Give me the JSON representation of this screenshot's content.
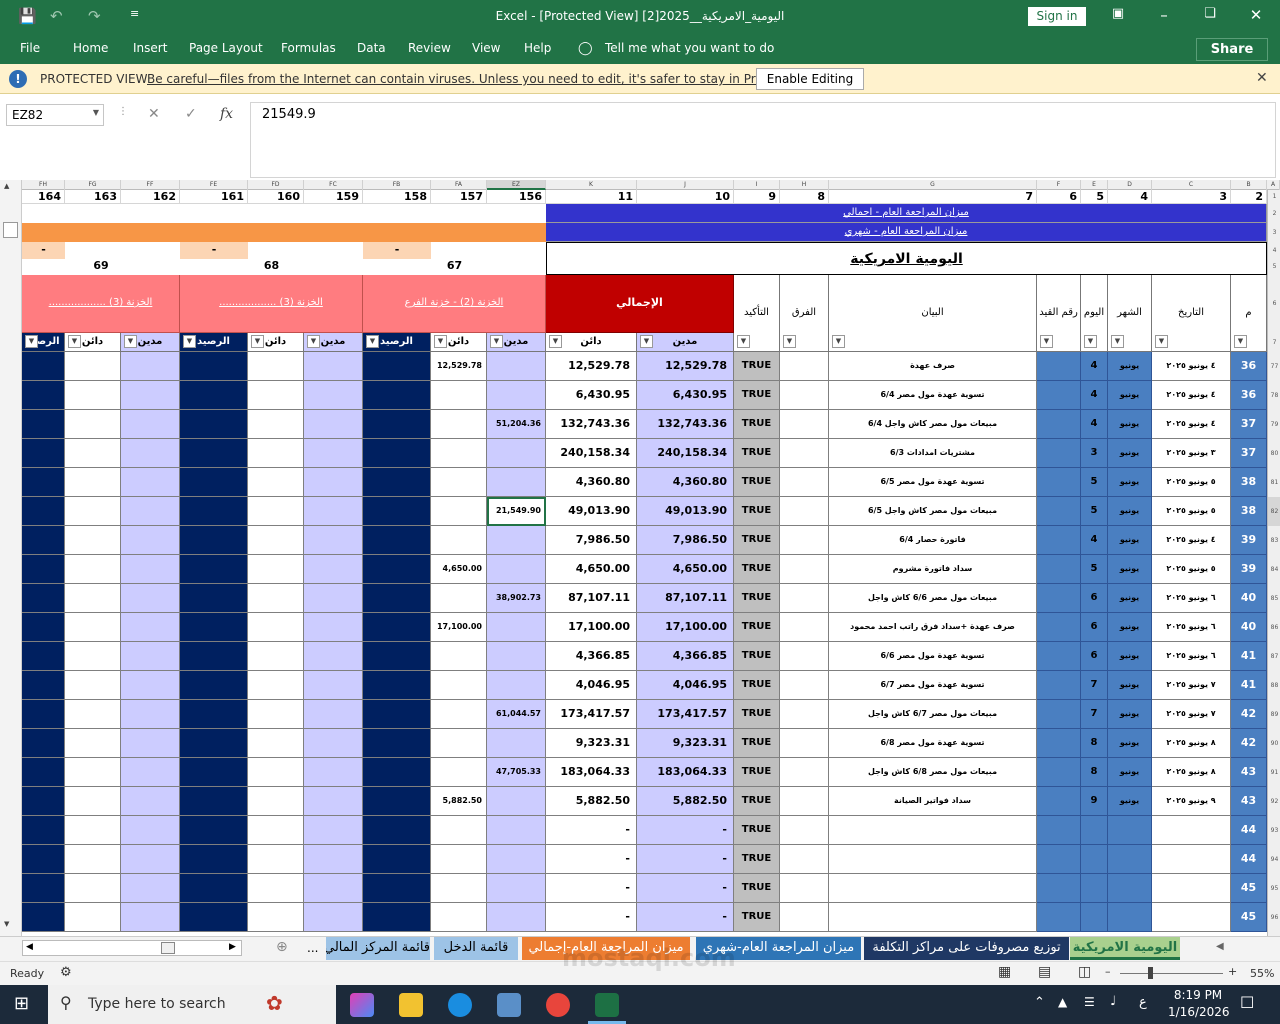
{
  "app": {
    "title": "اليومية_الامريكية__2025[2]  [Protected View]  -  Excel",
    "signin": "Sign in",
    "share": "Share"
  },
  "ribbon_tabs": [
    "File",
    "Home",
    "Insert",
    "Page Layout",
    "Formulas",
    "Data",
    "Review",
    "View",
    "Help"
  ],
  "tell_me": "Tell me what you want to do",
  "protected_view": {
    "label": "PROTECTED VIEW",
    "message": "Be careful—files from the Internet can contain viruses. Unless you need to edit, it's safer to stay in Protected View.",
    "button": "Enable Editing"
  },
  "formula_bar": {
    "name_box": "EZ82",
    "fx": "fx",
    "value": "21549.9"
  },
  "col_letters": [
    "FH",
    "FG",
    "FF",
    "FE",
    "FD",
    "FC",
    "FB",
    "FA",
    "EZ",
    "K",
    "J",
    "I",
    "H",
    "G",
    "F",
    "E",
    "D",
    "C",
    "B",
    "A"
  ],
  "row1_numbers": [
    "164",
    "163",
    "162",
    "161",
    "160",
    "159",
    "158",
    "157",
    "156",
    "11",
    "10",
    "9",
    "8",
    "7",
    "6",
    "5",
    "4",
    "3",
    "2"
  ],
  "banners": {
    "total_review": "ميزان المراجعة العام - اجمالي",
    "monthly_review": "ميزان المراجعة العام - شهري",
    "journal_title": "اليومية الامريكية"
  },
  "group_numbers": [
    "69",
    "68",
    "67"
  ],
  "dashes": [
    "-",
    "-",
    "-"
  ],
  "safes": {
    "safe3a": "الخزنة (3) ..................",
    "safe3b": "الخزنة (3) ..................",
    "safe2": "الخزنة (2) - خزنة الفرع",
    "total": "الإجمالي"
  },
  "headers": {
    "m": "م",
    "date": "التاريخ",
    "month": "الشهر",
    "day": "اليوم",
    "entry": "رقم القيد",
    "statement": "البيان",
    "diff": "الفرق",
    "confirm": "التأكيد",
    "debit": "مدين",
    "credit": "دائن",
    "balance": "الرصيد",
    "balance_cut": "الرصي"
  },
  "rows": [
    {
      "m": "36",
      "date": "٤ يونيو ٢٠٢٥",
      "month": "يونيو",
      "day": "4",
      "stmt": "صرف عهدة",
      "debit": "12,529.78",
      "credit": "12,529.78",
      "confirm": "TRUE",
      "ez": "",
      "fa": "12,529.78",
      "rn": "77"
    },
    {
      "m": "36",
      "date": "٤ يونيو ٢٠٢٥",
      "month": "يونيو",
      "day": "4",
      "stmt": "تسوية عهدة مول مصر 6/4",
      "debit": "6,430.95",
      "credit": "6,430.95",
      "confirm": "TRUE",
      "ez": "",
      "fa": "",
      "rn": "78"
    },
    {
      "m": "37",
      "date": "٤ يونيو ٢٠٢٥",
      "month": "يونيو",
      "day": "4",
      "stmt": "مبيعات مول مصر كاش واجل 6/4",
      "debit": "132,743.36",
      "credit": "132,743.36",
      "confirm": "TRUE",
      "ez": "51,204.36",
      "fa": "",
      "rn": "79"
    },
    {
      "m": "37",
      "date": "٣ يونيو ٢٠٢٥",
      "month": "يونيو",
      "day": "3",
      "stmt": "مشتريات امدادات 6/3",
      "debit": "240,158.34",
      "credit": "240,158.34",
      "confirm": "TRUE",
      "ez": "",
      "fa": "",
      "rn": "80"
    },
    {
      "m": "38",
      "date": "٥ يونيو ٢٠٢٥",
      "month": "يونيو",
      "day": "5",
      "stmt": "تسوية عهدة مول مصر 6/5",
      "debit": "4,360.80",
      "credit": "4,360.80",
      "confirm": "TRUE",
      "ez": "",
      "fa": "",
      "rn": "81"
    },
    {
      "m": "38",
      "date": "٥ يونيو ٢٠٢٥",
      "month": "يونيو",
      "day": "5",
      "stmt": "مبيعات مول مصر كاش واجل 6/5",
      "debit": "49,013.90",
      "credit": "49,013.90",
      "confirm": "TRUE",
      "ez": "21,549.90",
      "fa": "",
      "rn": "82"
    },
    {
      "m": "39",
      "date": "٤ يونيو ٢٠٢٥",
      "month": "يونيو",
      "day": "4",
      "stmt": "فاتورة حصار 6/4",
      "debit": "7,986.50",
      "credit": "7,986.50",
      "confirm": "TRUE",
      "ez": "",
      "fa": "",
      "rn": "83"
    },
    {
      "m": "39",
      "date": "٥ يونيو ٢٠٢٥",
      "month": "يونيو",
      "day": "5",
      "stmt": "سداد فاتورة مشروم",
      "debit": "4,650.00",
      "credit": "4,650.00",
      "confirm": "TRUE",
      "ez": "",
      "fa": "4,650.00",
      "rn": "84"
    },
    {
      "m": "40",
      "date": "٦ يونيو ٢٠٢٥",
      "month": "يونيو",
      "day": "6",
      "stmt": "مبيعات مول مصر 6/6 كاش واجل",
      "debit": "87,107.11",
      "credit": "87,107.11",
      "confirm": "TRUE",
      "ez": "38,902.73",
      "fa": "",
      "rn": "85"
    },
    {
      "m": "40",
      "date": "٦ يونيو ٢٠٢٥",
      "month": "يونيو",
      "day": "6",
      "stmt": "صرف عهدة +سداد فرق راتب احمد محمود",
      "debit": "17,100.00",
      "credit": "17,100.00",
      "confirm": "TRUE",
      "ez": "",
      "fa": "17,100.00",
      "rn": "86"
    },
    {
      "m": "41",
      "date": "٦ يونيو ٢٠٢٥",
      "month": "يونيو",
      "day": "6",
      "stmt": "تسوية عهدة مول مصر 6/6",
      "debit": "4,366.85",
      "credit": "4,366.85",
      "confirm": "TRUE",
      "ez": "",
      "fa": "",
      "rn": "87"
    },
    {
      "m": "41",
      "date": "٧ يونيو ٢٠٢٥",
      "month": "يونيو",
      "day": "7",
      "stmt": "تسوية عهدة مول مصر 6/7",
      "debit": "4,046.95",
      "credit": "4,046.95",
      "confirm": "TRUE",
      "ez": "",
      "fa": "",
      "rn": "88"
    },
    {
      "m": "42",
      "date": "٧ يونيو ٢٠٢٥",
      "month": "يونيو",
      "day": "7",
      "stmt": "مبيعات مول مصر 6/7 كاش واجل",
      "debit": "173,417.57",
      "credit": "173,417.57",
      "confirm": "TRUE",
      "ez": "61,044.57",
      "fa": "",
      "rn": "89"
    },
    {
      "m": "42",
      "date": "٨ يونيو ٢٠٢٥",
      "month": "يونيو",
      "day": "8",
      "stmt": "تسوية عهدة مول مصر 6/8",
      "debit": "9,323.31",
      "credit": "9,323.31",
      "confirm": "TRUE",
      "ez": "",
      "fa": "",
      "rn": "90"
    },
    {
      "m": "43",
      "date": "٨ يونيو ٢٠٢٥",
      "month": "يونيو",
      "day": "8",
      "stmt": "مبيعات مول مصر 6/8 كاش واجل",
      "debit": "183,064.33",
      "credit": "183,064.33",
      "confirm": "TRUE",
      "ez": "47,705.33",
      "fa": "",
      "rn": "91"
    },
    {
      "m": "43",
      "date": "٩ يونيو ٢٠٢٥",
      "month": "يونيو",
      "day": "9",
      "stmt": "سداد فواتير الصيانة",
      "debit": "5,882.50",
      "credit": "5,882.50",
      "confirm": "TRUE",
      "ez": "",
      "fa": "5,882.50",
      "rn": "92"
    },
    {
      "m": "44",
      "date": "",
      "month": "",
      "day": "",
      "stmt": "",
      "debit": "-",
      "credit": "-",
      "confirm": "TRUE",
      "ez": "",
      "fa": "",
      "rn": "93"
    },
    {
      "m": "44",
      "date": "",
      "month": "",
      "day": "",
      "stmt": "",
      "debit": "-",
      "credit": "-",
      "confirm": "TRUE",
      "ez": "",
      "fa": "",
      "rn": "94"
    },
    {
      "m": "45",
      "date": "",
      "month": "",
      "day": "",
      "stmt": "",
      "debit": "-",
      "credit": "-",
      "confirm": "TRUE",
      "ez": "",
      "fa": "",
      "rn": "95"
    },
    {
      "m": "45",
      "date": "",
      "month": "",
      "day": "",
      "stmt": "",
      "debit": "-",
      "credit": "-",
      "confirm": "TRUE",
      "ez": "",
      "fa": "",
      "rn": "96"
    }
  ],
  "top_row_numbers": [
    "1",
    "2",
    "3",
    "4",
    "5",
    "6",
    "7"
  ],
  "sheet_tabs": [
    {
      "label": "اليومية الامريكية",
      "bg": "#ffffff",
      "fg": "#217346",
      "active": true
    },
    {
      "label": "توزيع مصروفات على مراكز التكلفة",
      "bg": "#1f3864",
      "fg": "#ffffff"
    },
    {
      "label": "ميزان المراجعة العام-شهري",
      "bg": "#2e75b6",
      "fg": "#ffffff"
    },
    {
      "label": "ميزان المراجعة العام-إجمالي",
      "bg": "#ed7d31",
      "fg": "#ffffff"
    },
    {
      "label": "قائمة الدخل",
      "bg": "#9dc3e6",
      "fg": "#000000"
    },
    {
      "label": "قائمة المركز المالي",
      "bg": "#9dc3e6",
      "fg": "#000000"
    }
  ],
  "sheet_more": "...",
  "status": {
    "ready": "Ready",
    "zoom": "55%"
  },
  "taskbar": {
    "search": "Type here to search",
    "time": "8:19 PM",
    "date": "1/16/2026",
    "lang": "ع"
  },
  "watermark": "mostaql.com",
  "colors": {
    "excel_green": "#217346",
    "navy": "#002060",
    "lavender": "#ccccff",
    "blue_col": "#4a7fc1",
    "pink": "#ff7c80",
    "red_header": "#c00000",
    "orange": "#f79646",
    "banner_blue": "#3333cc"
  }
}
